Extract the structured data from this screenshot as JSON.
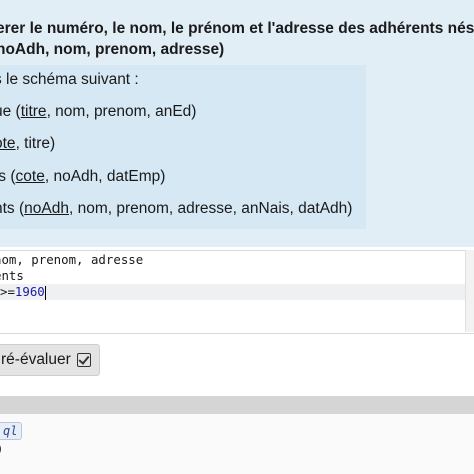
{
  "question": {
    "line1": "erer le numéro, le nom, le prénom et l'adresse des adhérents nés en",
    "line2": "noAdh, nom, prenom, adresse)"
  },
  "schema": {
    "intro": "s le schéma suivant :",
    "rows": [
      {
        "name": "ue",
        "open": " (",
        "key": "titre",
        "rest": ", nom, prenom, anEd)"
      },
      {
        "name": "",
        "open": "",
        "key": "ote",
        "rest": ", titre)"
      },
      {
        "name": "ts",
        "open": " (",
        "key": "cote",
        "rest": ", noAdh, datEmp)"
      },
      {
        "name": "nts",
        "open": " (",
        "key": "noAdh",
        "rest": ", nom, prenom, adresse, anNais, datAdh)"
      }
    ]
  },
  "editor": {
    "line1": " nom, prenom, adresse",
    "line2": "ents",
    "line3_prefix": ">=",
    "line3_number": "1960"
  },
  "button": {
    "label": "ré-évaluer",
    "icon": "check-square-icon"
  },
  "output": {
    "tag": "ql",
    "text": ")"
  }
}
